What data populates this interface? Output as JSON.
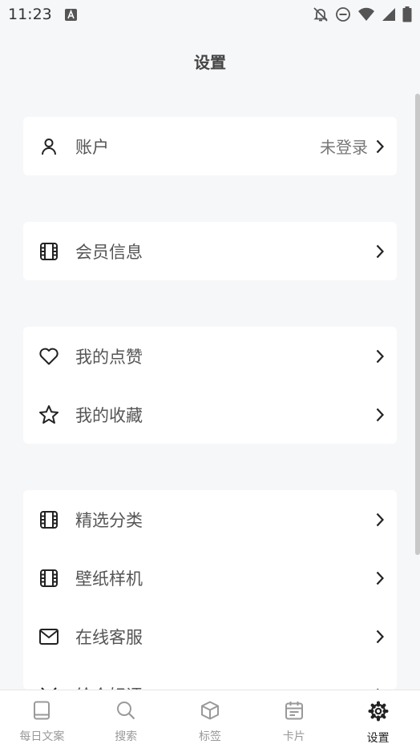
{
  "status_bar": {
    "time": "11:23"
  },
  "page": {
    "title": "设置"
  },
  "groups": [
    {
      "items": [
        {
          "label": "账户",
          "value": "未登录",
          "icon": "user-icon"
        }
      ]
    },
    {
      "items": [
        {
          "label": "会员信息",
          "icon": "film-icon"
        }
      ]
    },
    {
      "items": [
        {
          "label": "我的点赞",
          "icon": "heart-icon"
        },
        {
          "label": "我的收藏",
          "icon": "star-icon"
        }
      ]
    },
    {
      "items": [
        {
          "label": "精选分类",
          "icon": "film-icon"
        },
        {
          "label": "壁纸样机",
          "icon": "film-icon"
        },
        {
          "label": "在线客服",
          "icon": "mail-icon"
        },
        {
          "label": "给个好评",
          "icon": "gift-icon"
        }
      ]
    }
  ],
  "bottom_nav": [
    {
      "label": "每日文案",
      "icon": "book-icon",
      "active": false
    },
    {
      "label": "搜索",
      "icon": "search-icon",
      "active": false
    },
    {
      "label": "标签",
      "icon": "cube-icon",
      "active": false
    },
    {
      "label": "卡片",
      "icon": "calendar-icon",
      "active": false
    },
    {
      "label": "设置",
      "icon": "gear-icon",
      "active": true
    }
  ],
  "colors": {
    "background": "#f6f7f9",
    "card": "#ffffff",
    "text": "#555555",
    "active": "#222222",
    "inactive": "#999999"
  }
}
